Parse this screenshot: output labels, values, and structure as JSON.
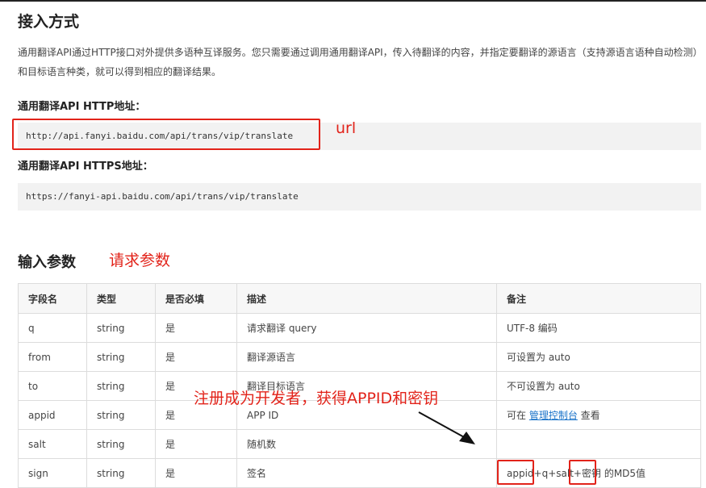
{
  "section_title": "接入方式",
  "intro_text": "通用翻译API通过HTTP接口对外提供多语种互译服务。您只需要通过调用通用翻译API，传入待翻译的内容，并指定要翻译的源语言（支持源语言语种自动检测）和目标语言种类，就可以得到相应的翻译结果。",
  "http_label": "通用翻译API HTTP地址：",
  "http_url": "http://api.fanyi.baidu.com/api/trans/vip/translate",
  "https_label": "通用翻译API HTTPS地址：",
  "https_url": "https://fanyi-api.baidu.com/api/trans/vip/translate",
  "params_title": "输入参数",
  "annotations": {
    "url": "url",
    "request_params": "请求参数",
    "register": "注册成为开发者，获得APPID和密钥",
    "color": "#e2231a"
  },
  "table": {
    "headers": [
      "字段名",
      "类型",
      "是否必填",
      "描述",
      "备注"
    ],
    "rows": [
      [
        "q",
        "string",
        "是",
        "请求翻译 query",
        "UTF-8 编码"
      ],
      [
        "from",
        "string",
        "是",
        "翻译源语言",
        "可设置为 auto"
      ],
      [
        "to",
        "string",
        "是",
        "翻译目标语言",
        "不可设置为 auto"
      ],
      [
        "appid",
        "string",
        "是",
        "APP ID",
        ""
      ],
      [
        "salt",
        "string",
        "是",
        "随机数",
        ""
      ],
      [
        "sign",
        "string",
        "是",
        "签名",
        ""
      ]
    ],
    "appid_note": {
      "prefix": "可在 ",
      "link": "管理控制台",
      "suffix": " 查看"
    },
    "sign_note": {
      "part1": "appid",
      "part2": "+q+salt+",
      "part3": "密钥",
      "part4": " 的MD5值"
    }
  }
}
